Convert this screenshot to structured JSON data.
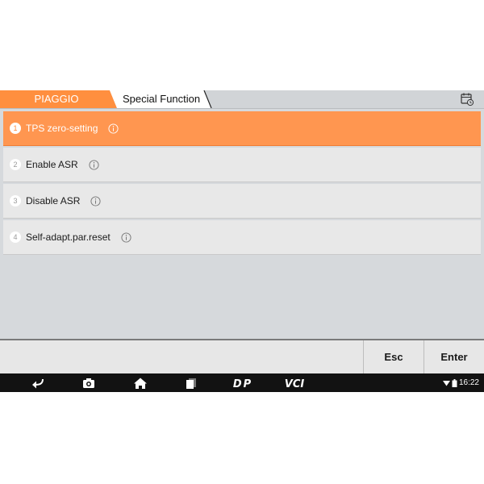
{
  "header": {
    "brand": "PIAGGIO",
    "section": "Special Function",
    "calendar_icon": "calendar-clock-icon"
  },
  "items": [
    {
      "num": "1",
      "label": "TPS zero-setting",
      "active": true
    },
    {
      "num": "2",
      "label": "Enable ASR",
      "active": false
    },
    {
      "num": "3",
      "label": "Disable ASR",
      "active": false
    },
    {
      "num": "4",
      "label": "Self-adapt.par.reset",
      "active": false
    }
  ],
  "buttons": {
    "esc": "Esc",
    "enter": "Enter"
  },
  "navbar": {
    "icons": [
      "back-icon",
      "camera-icon",
      "home-icon",
      "recent-apps-icon",
      "dp-icon",
      "vci-icon"
    ],
    "dp_label": "DP",
    "vci_label": "VCI",
    "time": "16:22"
  },
  "colors": {
    "accent": "#ff9650",
    "background": "#d6d9dc",
    "navbar": "#121212"
  }
}
